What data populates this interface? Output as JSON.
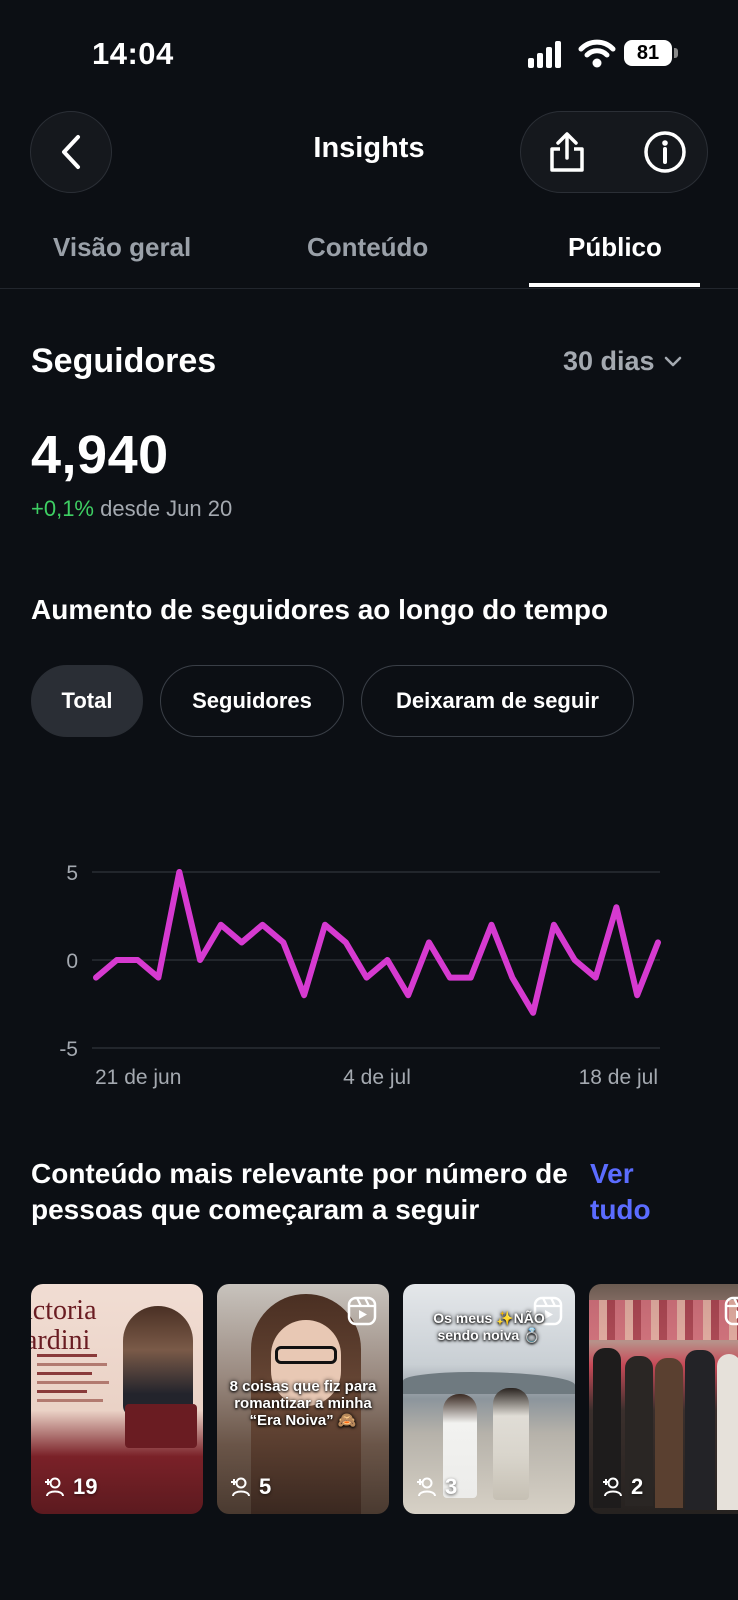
{
  "status_bar": {
    "time": "14:04",
    "battery": "81"
  },
  "header": {
    "title": "Insights"
  },
  "tabs": [
    {
      "label": "Visão geral",
      "active": false
    },
    {
      "label": "Conteúdo",
      "active": false
    },
    {
      "label": "Público",
      "active": true
    }
  ],
  "followers": {
    "title": "Seguidores",
    "period": "30 dias",
    "count": "4,940",
    "change_pct": "+0,1%",
    "change_since": "desde Jun 20"
  },
  "growth": {
    "title": "Aumento de seguidores ao longo do tempo",
    "filters": [
      {
        "label": "Total",
        "active": true
      },
      {
        "label": "Seguidores",
        "active": false
      },
      {
        "label": "Deixaram de seguir",
        "active": false
      }
    ]
  },
  "chart_data": {
    "type": "line",
    "x_tick_labels": [
      "21 de jun",
      "4 de jul",
      "18 de jul"
    ],
    "y_tick_labels": [
      "5",
      "0",
      "-5"
    ],
    "ylim": [
      -5,
      5
    ],
    "color": "#d63ad0",
    "grid": true,
    "series": [
      {
        "values": [
          -1,
          0,
          0,
          -1,
          5,
          0,
          2,
          1,
          2,
          1,
          -2,
          2,
          1,
          -1,
          0,
          -2,
          1,
          -1,
          -1,
          2,
          -1,
          -3,
          2,
          0,
          -1,
          3,
          -2,
          1
        ]
      }
    ]
  },
  "top_content": {
    "title": "Conteúdo mais relevante por número de pessoas que começaram a seguir",
    "see_all": "Ver tudo",
    "items": [
      {
        "count": "19",
        "type": "post",
        "caption": "",
        "title_text": "ictoria ardini"
      },
      {
        "count": "5",
        "type": "reel",
        "caption": "8 coisas que fiz para romantizar a minha “Era Noiva” 🙈"
      },
      {
        "count": "3",
        "type": "reel",
        "caption": "Os meus ✨NÃO sendo noiva 💍"
      },
      {
        "count": "2",
        "type": "reel",
        "caption": ""
      }
    ]
  }
}
